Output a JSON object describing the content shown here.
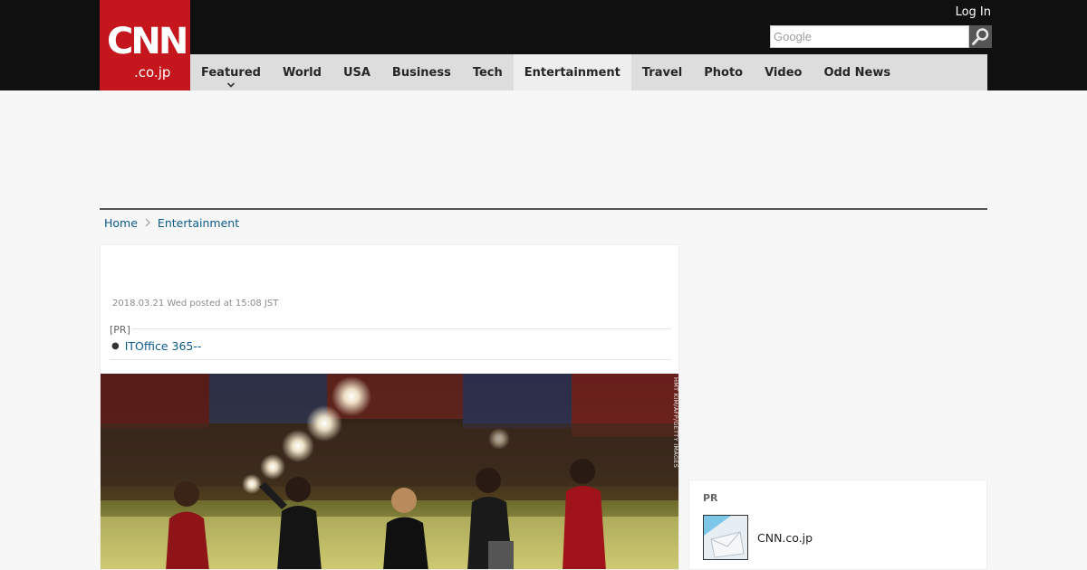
{
  "header": {
    "logo": {
      "main": "CNN",
      "sub": ".co.jp"
    },
    "login_label": "Log In",
    "search": {
      "placeholder": "Google",
      "value": ""
    },
    "nav": [
      {
        "label": "Featured",
        "has_dropdown": true,
        "active": false
      },
      {
        "label": "World",
        "active": false
      },
      {
        "label": "USA",
        "active": false
      },
      {
        "label": "Business",
        "active": false
      },
      {
        "label": "Tech",
        "active": false
      },
      {
        "label": "Entertainment",
        "active": true
      },
      {
        "label": "Travel",
        "active": false
      },
      {
        "label": "Photo",
        "active": false
      },
      {
        "label": "Video",
        "active": false
      },
      {
        "label": "Odd News",
        "active": false
      }
    ]
  },
  "breadcrumb": [
    "Home",
    "Entertainment"
  ],
  "article": {
    "dateline": "2018.03.21 Wed posted at 15:08 JST",
    "pr": {
      "tag": "[PR]",
      "link": "ITOffice 365--"
    },
    "photo": {
      "credit": "HMT KIM/AFP/GETTY IMAGES",
      "icon": "concert-stage-photo"
    }
  },
  "sidebar": {
    "pr_title": "PR",
    "pr_item": {
      "label": "CNN.co.jp",
      "icon": "mail-envelope-thumbnail"
    }
  },
  "colors": {
    "brand_red": "#c4161c",
    "topbar": "#101010",
    "nav_bg": "#dddddd",
    "nav_active": "#eeeeee",
    "link": "#0c5a8a"
  }
}
